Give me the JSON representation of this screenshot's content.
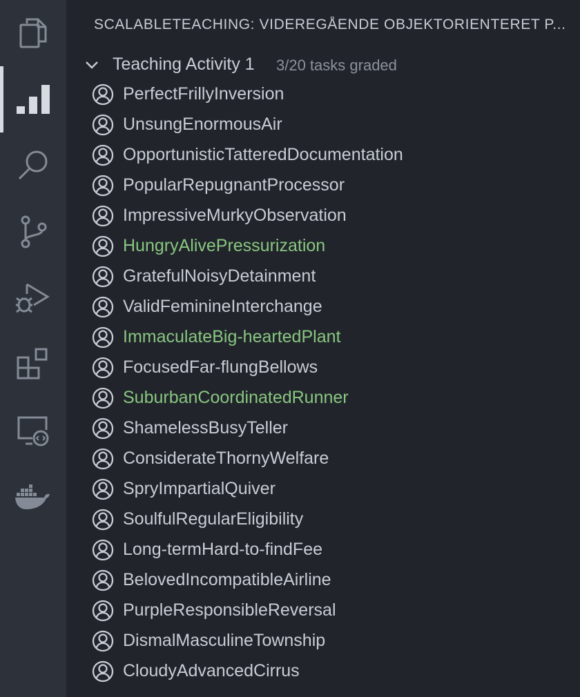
{
  "activity_bar": {
    "items": [
      {
        "name": "explorer",
        "icon": "files-icon",
        "active": false
      },
      {
        "name": "scalableteaching",
        "icon": "bar-chart-icon",
        "active": true
      },
      {
        "name": "search",
        "icon": "search-icon",
        "active": false
      },
      {
        "name": "source-control",
        "icon": "source-control-icon",
        "active": false
      },
      {
        "name": "run-debug",
        "icon": "run-debug-icon",
        "active": false
      },
      {
        "name": "extensions",
        "icon": "extensions-icon",
        "active": false
      },
      {
        "name": "remote-explorer",
        "icon": "remote-explorer-icon",
        "active": false
      },
      {
        "name": "docker",
        "icon": "docker-icon",
        "active": false
      }
    ]
  },
  "sidebar": {
    "title": "SCALABLETEACHING: VIDEREGÅENDE OBJEKTORIENTERET P...",
    "group": {
      "label": "Teaching Activity 1",
      "description": "3/20 tasks graded",
      "icon": "chevron-down-icon"
    },
    "tasks": [
      {
        "label": "PerfectFrillyInversion",
        "graded": false
      },
      {
        "label": "UnsungEnormousAir",
        "graded": false
      },
      {
        "label": "OpportunisticTatteredDocumentation",
        "graded": false
      },
      {
        "label": "PopularRepugnantProcessor",
        "graded": false
      },
      {
        "label": "ImpressiveMurkyObservation",
        "graded": false
      },
      {
        "label": "HungryAlivePressurization",
        "graded": true
      },
      {
        "label": "GratefulNoisyDetainment",
        "graded": false
      },
      {
        "label": "ValidFeminineInterchange",
        "graded": false
      },
      {
        "label": "ImmaculateBig-heartedPlant",
        "graded": true
      },
      {
        "label": "FocusedFar-flungBellows",
        "graded": false
      },
      {
        "label": "SuburbanCoordinatedRunner",
        "graded": true
      },
      {
        "label": "ShamelessBusyTeller",
        "graded": false
      },
      {
        "label": "ConsiderateThornyWelfare",
        "graded": false
      },
      {
        "label": "SpryImpartialQuiver",
        "graded": false
      },
      {
        "label": "SoulfulRegularEligibility",
        "graded": false
      },
      {
        "label": "Long-termHard-to-findFee",
        "graded": false
      },
      {
        "label": "BelovedIncompatibleAirline",
        "graded": false
      },
      {
        "label": "PurpleResponsibleReversal",
        "graded": false
      },
      {
        "label": "DismalMasculineTownship",
        "graded": false
      },
      {
        "label": "CloudyAdvancedCirrus",
        "graded": false
      }
    ]
  },
  "colors": {
    "activity_bar_bg": "#2c313a",
    "sidebar_bg": "#21252b",
    "text": "#c8ccd4",
    "muted_text": "#8b919c",
    "graded_text": "#89c680",
    "icon": "#858b96",
    "active_icon": "#d7dae0"
  }
}
